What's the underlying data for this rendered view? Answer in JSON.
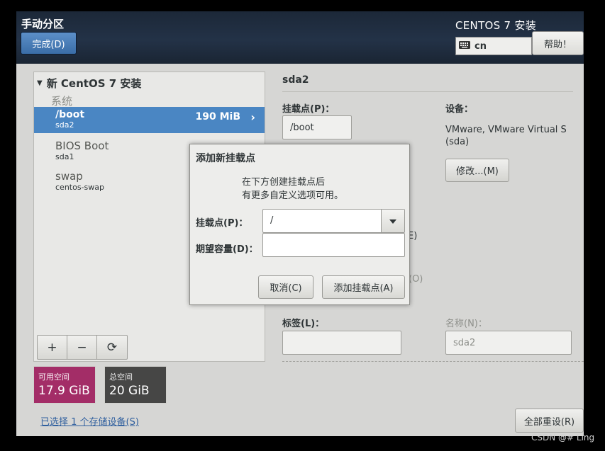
{
  "header": {
    "title": "手动分区",
    "done_label": "完成(D)",
    "product_title": "CENTOS 7 安装",
    "keyboard_layout": "cn",
    "help_label": "帮助！"
  },
  "left_panel": {
    "tree_title": "新 CentOS 7 安装",
    "section_label": "系统",
    "partitions": [
      {
        "mount": "/boot",
        "device": "sda2",
        "size": "190 MiB",
        "selected": true
      },
      {
        "mount": "BIOS Boot",
        "device": "sda1",
        "size": "",
        "selected": false
      },
      {
        "mount": "swap",
        "device": "centos-swap",
        "size": "",
        "selected": false
      }
    ],
    "toolbar": {
      "add": "+",
      "remove": "−",
      "refresh": "⟳"
    },
    "available_space": {
      "label": "可用空间",
      "value": "17.9 GiB"
    },
    "total_space": {
      "label": "总空间",
      "value": "20 GiB"
    },
    "storage_link": "已选择 1 个存储设备(S)"
  },
  "details": {
    "title": "sda2",
    "mount_point_label": "挂载点(P)：",
    "mount_point_value": "/boot",
    "device_label": "设备：",
    "device_text_line1": "VMware, VMware Virtual S",
    "device_text_line2": "(sda)",
    "modify_label": "修改...(M)",
    "hidden_text_1": "E)",
    "hidden_text_2": "(O)",
    "label_label": "标签(L)：",
    "label_value": "",
    "name_label": "名称(N)：",
    "name_value": "sda2",
    "reset_label": "全部重设(R)"
  },
  "dialog": {
    "title": "添加新挂载点",
    "message_line1": "在下方创建挂载点后",
    "message_line2": "有更多自定义选项可用。",
    "mount_label": "挂载点(P)：",
    "mount_value": "/",
    "capacity_label": "期望容量(D)：",
    "capacity_value": "",
    "cancel_label": "取消(C)",
    "add_label": "添加挂载点(A)"
  },
  "watermark": "CSDN @#  Ling",
  "colors": {
    "selected_row": "#4a86c3",
    "available_space": "#a32d67",
    "total_space": "#464645",
    "done_button": "#3a6da7"
  }
}
